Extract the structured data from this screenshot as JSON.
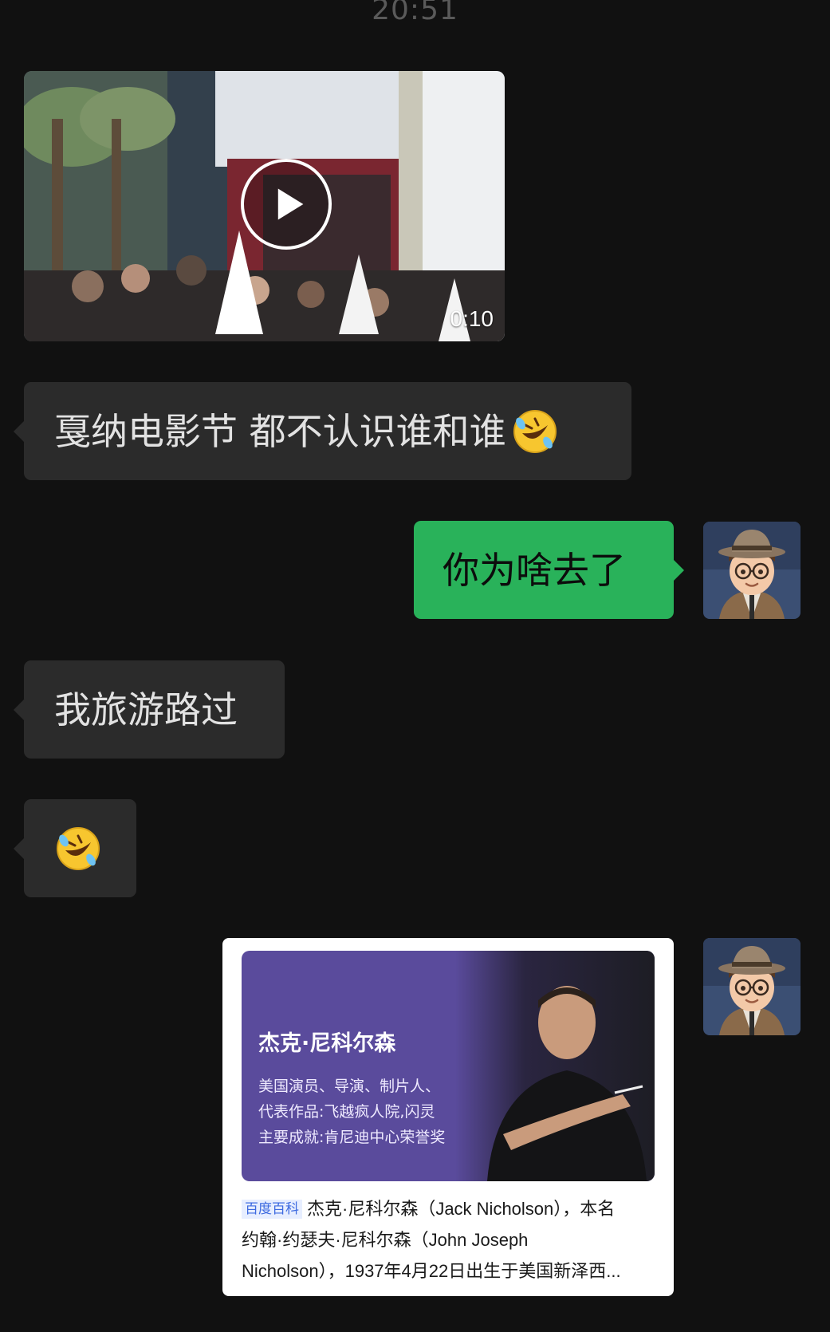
{
  "header": {
    "time": "20:51"
  },
  "messages": [
    {
      "type": "video",
      "direction": "incoming",
      "duration": "0:10"
    },
    {
      "type": "text",
      "direction": "incoming",
      "text": "戛纳电影节 都不认识谁和谁",
      "emoji": "rolling-on-floor-laughing"
    },
    {
      "type": "text",
      "direction": "outgoing",
      "text": "你为啥去了"
    },
    {
      "type": "text",
      "direction": "incoming",
      "text": "我旅游路过"
    },
    {
      "type": "emoji",
      "direction": "incoming",
      "emoji": "rolling-on-floor-laughing"
    },
    {
      "type": "link_card",
      "direction": "outgoing",
      "banner": {
        "title": "杰克·尼科尔森",
        "line1": "美国演员、导演、制片人、",
        "line2": "代表作品:飞越疯人院,闪灵",
        "line3": "主要成就:肯尼迪中心荣誉奖"
      },
      "source": "百度百科",
      "summary_line1": "杰克·尼科尔森（Jack Nicholson），本名",
      "summary_line2": "约翰·约瑟夫·尼科尔森（John Joseph",
      "summary_line3": "Nicholson），1937年4月22日出生于美国新泽西..."
    }
  ],
  "colors": {
    "background": "#111111",
    "incoming_bubble": "#2b2b2b",
    "outgoing_bubble": "#29b25a",
    "card_banner": "#5a4b9c"
  },
  "icons": [
    "play-icon",
    "rolling-on-floor-laughing-emoji",
    "avatar-cartoon-man"
  ]
}
